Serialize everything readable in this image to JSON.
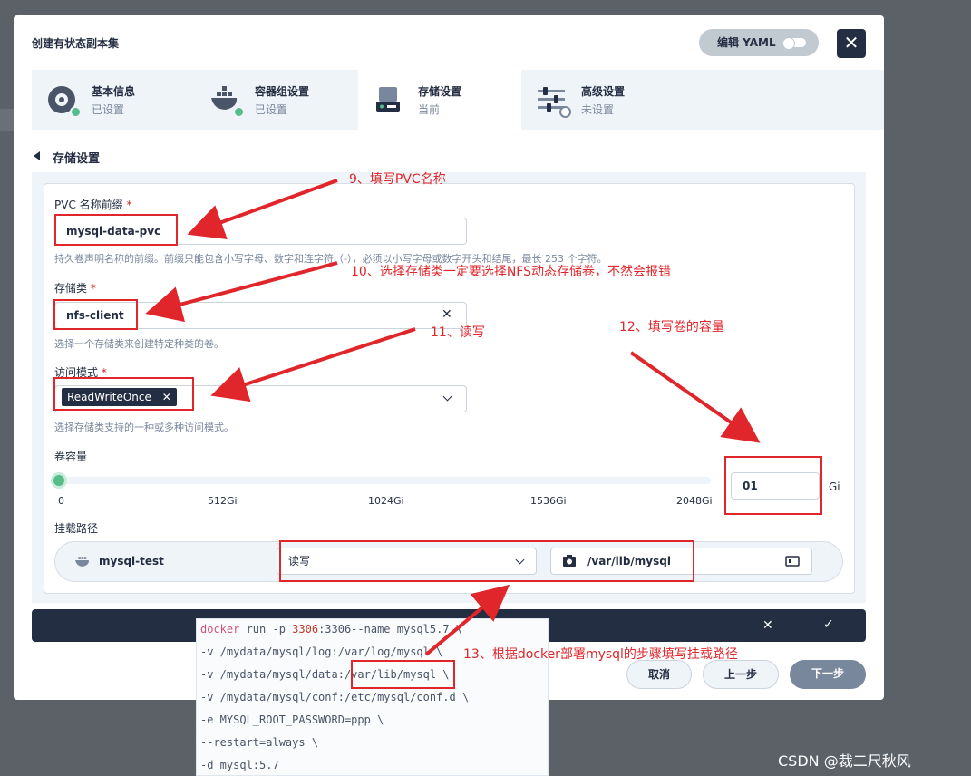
{
  "dialog": {
    "title": "创建有状态副本集",
    "yaml_label": "编辑 YAML",
    "close": "✕"
  },
  "steps": [
    {
      "name": "基本信息",
      "status": "已设置"
    },
    {
      "name": "容器组设置",
      "status": "已设置"
    },
    {
      "name": "存储设置",
      "status": "当前"
    },
    {
      "name": "高级设置",
      "status": "未设置"
    }
  ],
  "section_title": "存储设置",
  "pvc": {
    "label": "PVC 名称前缀",
    "required": "*",
    "value": "mysql-data-pvc",
    "help": "持久卷声明名称的前缀。前缀只能包含小写字母、数字和连字符（-），必须以小写字母或数字开头和结尾，最长 253 个字符。"
  },
  "storage_class": {
    "label": "存储类",
    "required": "*",
    "value": "nfs-client",
    "clear": "✕",
    "help": "选择一个存储类来创建特定种类的卷。"
  },
  "access_mode": {
    "label": "访问模式",
    "required": "*",
    "tag": "ReadWriteOnce",
    "tag_remove": "✕",
    "help": "选择存储类支持的一种或多种访问模式。"
  },
  "capacity": {
    "label": "卷容量",
    "ticks": [
      "0",
      "512Gi",
      "1024Gi",
      "1536Gi",
      "2048Gi"
    ],
    "value": "01",
    "unit": "Gi",
    "slider_fraction": 0
  },
  "mount": {
    "label": "挂载路径",
    "container": "mysql-test",
    "mode": "读写",
    "path": "/var/lib/mysql"
  },
  "footer": {
    "cancel": "取消",
    "prev": "上一步",
    "next": "下一步",
    "close": "✕",
    "confirm": "✓"
  },
  "code": {
    "lines": [
      "docker run -p 3306:3306--name mysql5.7 \\",
      "-v /mydata/mysql/log:/var/log/mysql \\",
      "-v /mydata/mysql/data:/var/lib/mysql \\",
      "-v /mydata/mysql/conf:/etc/mysql/conf.d \\",
      "-e MYSQL_ROOT_PASSWORD=ppp \\",
      "--restart=always \\",
      "-d mysql:5.7"
    ]
  },
  "annotations": {
    "a9": "9、填写PVC名称",
    "a10": "10、选择存储类一定要选择NFS动态存储卷，不然会报错",
    "a11": "11、读写",
    "a12": "12、填写卷的容量",
    "a13": "13、根据docker部署mysql的步骤填写挂载路径"
  },
  "watermark": "CSDN @裁二尺秋风",
  "colors": {
    "accent": "#55bc8a",
    "dark": "#242e42",
    "annotation_red": "#e0262b"
  }
}
